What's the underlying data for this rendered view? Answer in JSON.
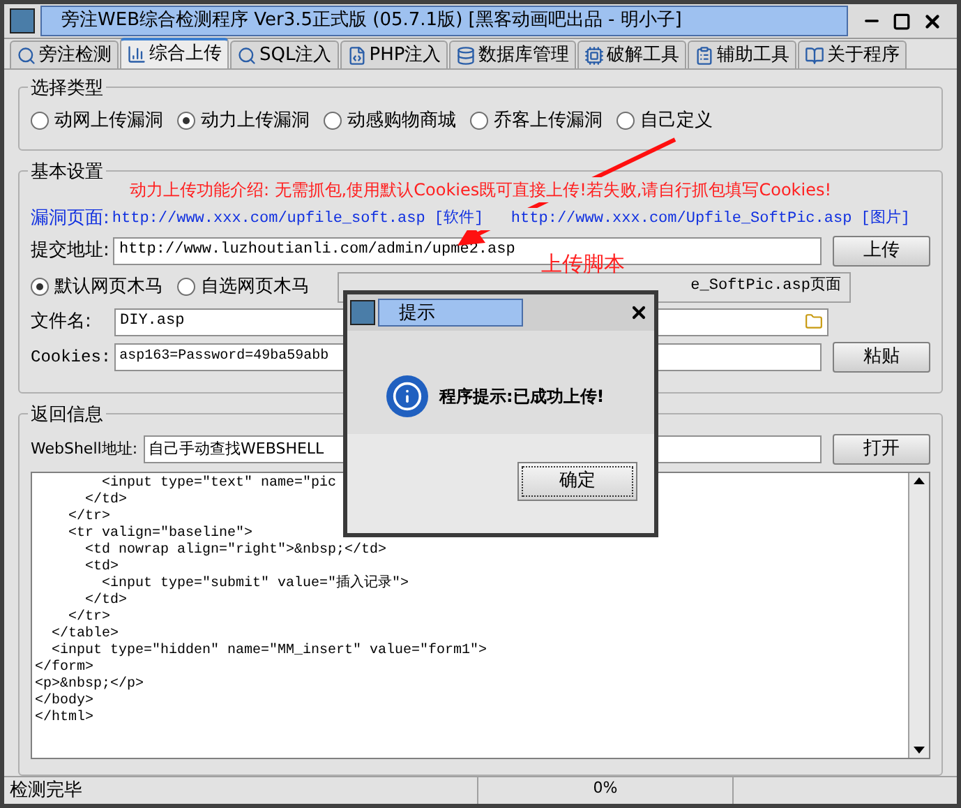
{
  "window": {
    "title": "旁注WEB综合检测程序 Ver3.5正式版 (05.7.1版) [黑客动画吧出品 - 明小子]"
  },
  "tabs": [
    {
      "label": "旁注检测",
      "selected": false
    },
    {
      "label": "综合上传",
      "selected": true
    },
    {
      "label": "SQL注入",
      "selected": false
    },
    {
      "label": "PHP注入",
      "selected": false
    },
    {
      "label": "数据库管理",
      "selected": false
    },
    {
      "label": "破解工具",
      "selected": false
    },
    {
      "label": "辅助工具",
      "selected": false
    },
    {
      "label": "关于程序",
      "selected": false
    }
  ],
  "type_group": {
    "title": "选择类型",
    "options": [
      {
        "label": "动网上传漏洞",
        "selected": false
      },
      {
        "label": "动力上传漏洞",
        "selected": true
      },
      {
        "label": "动感购物商城",
        "selected": false
      },
      {
        "label": "乔客上传漏洞",
        "selected": false
      },
      {
        "label": "自己定义",
        "selected": false
      }
    ]
  },
  "basic_group": {
    "title": "基本设置",
    "notice": "动力上传功能介绍: 无需抓包,使用默认Cookies既可直接上传!若失败,请自行抓包填写Cookies!",
    "vuln_label": "漏洞页面:",
    "vuln_pages": "http://www.xxx.com/upfile_soft.asp [软件]   http://www.xxx.com/Upfile_SoftPic.asp [图片]",
    "submit_label": "提交地址:",
    "submit_value": "http://www.luzhoutianli.com/admin/upme2.asp",
    "upload_button": "上传",
    "trojan_options": [
      {
        "label": "默认网页木马",
        "selected": true
      },
      {
        "label": "自选网页木马",
        "selected": false
      }
    ],
    "page_option_text": "e_SoftPic.asp页面",
    "filename_label": "文件名:",
    "filename_value": "DIY.asp",
    "cookies_label": "Cookies:",
    "cookies_value": "asp163=Password=49ba59abb",
    "paste_button": "粘贴"
  },
  "result_group": {
    "title": "返回信息",
    "webshell_label": "WebShell地址:",
    "webshell_value": "自己手动查找WEBSHELL",
    "open_button": "打开",
    "code_lines": [
      "        <input type=\"text\" name=\"pic",
      "      </td>",
      "    </tr>",
      "    <tr valign=\"baseline\">",
      "      <td nowrap align=\"right\">&nbsp;</td>",
      "      <td>",
      "        <input type=\"submit\" value=\"插入记录\">",
      "      </td>",
      "    </tr>",
      "  </table>",
      "  <input type=\"hidden\" name=\"MM_insert\" value=\"form1\">",
      "</form>",
      "<p>&nbsp;</p>",
      "</body>",
      "</html>"
    ]
  },
  "annotation": "上传脚本",
  "dialog": {
    "title": "提示",
    "message": "程序提示:已成功上传!",
    "ok_button": "确定"
  },
  "status_bar": {
    "status": "检测完毕",
    "progress": "0%"
  }
}
